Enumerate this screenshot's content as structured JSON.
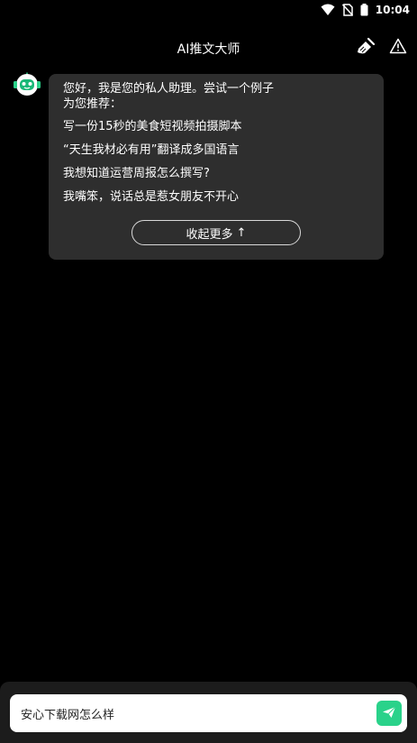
{
  "status_bar": {
    "time": "10:04",
    "icons": [
      "wifi-icon",
      "no-sim-icon",
      "battery-icon"
    ]
  },
  "header": {
    "title": "AI推文大师",
    "actions": [
      "broom-icon",
      "warning-icon"
    ]
  },
  "chat": {
    "greeting": "您好，我是您的私人助理。尝试一个例子为您推荐：",
    "suggestions": [
      "写一份15秒的美食短视频拍摄脚本",
      "“天生我材必有用”翻译成多国语言",
      "我想知道运营周报怎么撰写?",
      "我嘴笨，说话总是惹女朋友不开心"
    ],
    "collapse_label": "收起更多",
    "collapse_arrow": "↑"
  },
  "input": {
    "value": "安心下载网怎么样",
    "placeholder": ""
  },
  "colors": {
    "background": "#000000",
    "bubble": "#2e2e2e",
    "accent": "#2ad28a",
    "input_bar": "#1c1c1c"
  }
}
